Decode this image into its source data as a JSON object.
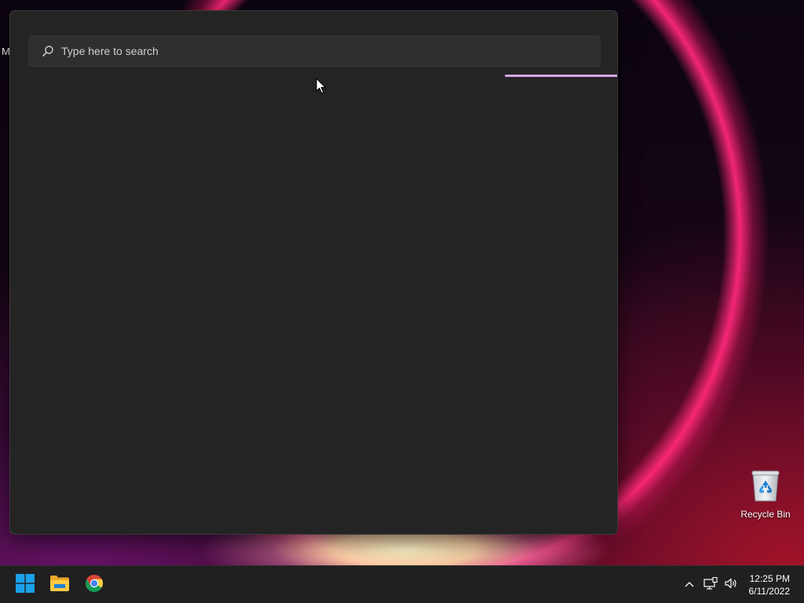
{
  "desktop": {
    "left_edge_text": "M",
    "icons": [
      {
        "label": "Recycle Bin",
        "icon": "recycle-bin-icon"
      }
    ]
  },
  "start_menu": {
    "search": {
      "placeholder": "Type here to search",
      "value": ""
    },
    "loading_indicator": {
      "accent": "#d9a6e6"
    }
  },
  "taskbar": {
    "pinned": [
      {
        "name": "Start",
        "icon": "windows-logo-icon"
      },
      {
        "name": "File Explorer",
        "icon": "file-explorer-icon"
      },
      {
        "name": "Google Chrome",
        "icon": "chrome-icon"
      }
    ],
    "tray": {
      "icons": [
        "chevron-up-icon",
        "network-icon",
        "speaker-icon"
      ]
    },
    "clock": {
      "time": "12:25 PM",
      "date": "6/11/2022"
    }
  },
  "colors": {
    "panel_bg": "#242424",
    "search_bg": "#2f2f2f",
    "taskbar_bg": "#202020",
    "windows_blue": "#1aa1ea"
  }
}
